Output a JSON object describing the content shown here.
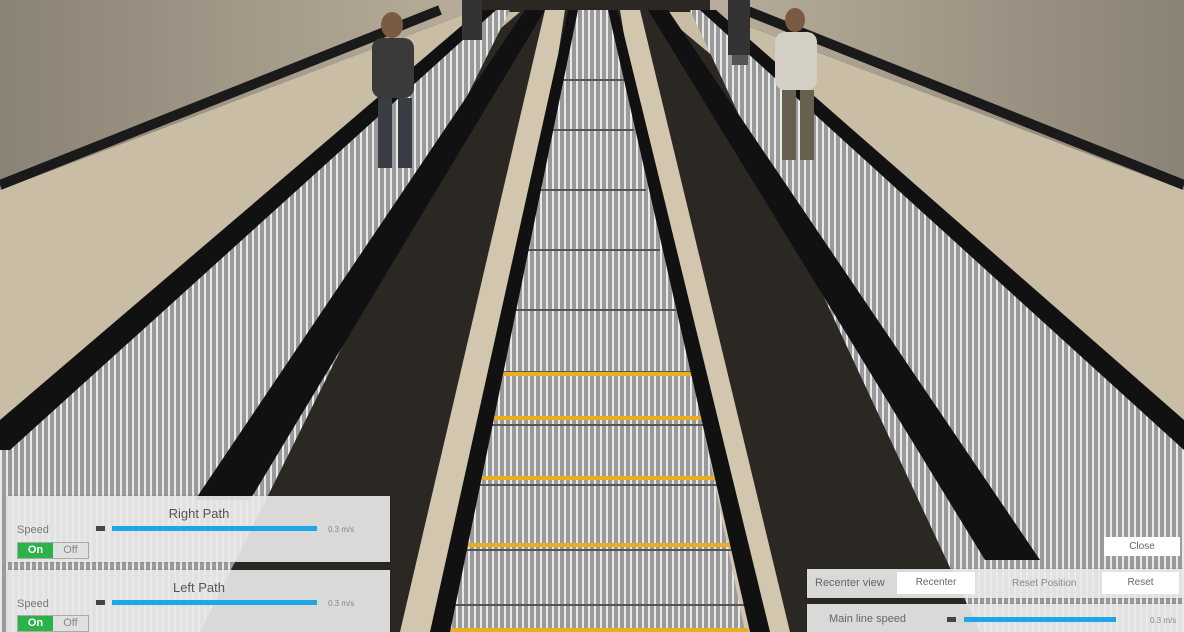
{
  "left_panel": {
    "right_path": {
      "title": "Right Path",
      "speed_label": "Speed",
      "speed_value": "0.3 m/s",
      "on_label": "On",
      "off_label": "Off"
    },
    "left_path": {
      "title": "Left Path",
      "speed_label": "Speed",
      "speed_value": "0.3 m/s",
      "on_label": "On",
      "off_label": "Off"
    }
  },
  "right_panel": {
    "close_label": "Close",
    "recenter_view_label": "Recenter view",
    "recenter_button": "Recenter",
    "reset_position_label": "Reset Position",
    "reset_button": "Reset",
    "main_line_speed_label": "Main line speed",
    "main_line_speed_value": "0.3 m/s"
  },
  "colors": {
    "accent_blue": "#1ea7e8",
    "toggle_on_green": "#2bb34a",
    "step_edge_yellow": "#e8b020"
  }
}
